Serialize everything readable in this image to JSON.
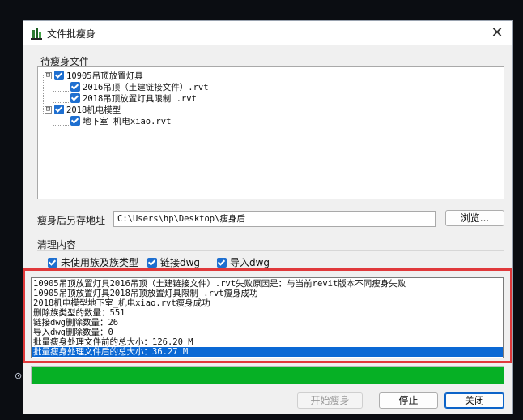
{
  "window": {
    "title": "文件批瘦身",
    "close_glyph": "✕"
  },
  "files_section": {
    "label": "待瘦身文件",
    "tree": [
      {
        "label": "10905吊顶放置灯具",
        "expander": "⊟",
        "checked": true,
        "children": [
          {
            "label": "2016吊顶（土建链接文件）.rvt",
            "checked": true
          },
          {
            "label": "2018吊顶放置灯具限制 .rvt",
            "checked": true
          }
        ]
      },
      {
        "label": "2018机电模型",
        "expander": "⊟",
        "checked": true,
        "children": [
          {
            "label": "地下室_机电xiao.rvt",
            "checked": true
          }
        ]
      }
    ]
  },
  "save_path": {
    "label": "瘦身后另存地址",
    "value": "C:\\Users\\hp\\Desktop\\瘦身后",
    "browse_label": "浏览..."
  },
  "cleanup": {
    "label": "清理内容",
    "options": [
      {
        "label": "未使用族及族类型",
        "checked": true
      },
      {
        "label": "链接dwg",
        "checked": true
      },
      {
        "label": "导入dwg",
        "checked": true
      }
    ]
  },
  "log": {
    "lines": [
      "10905吊顶放置灯具2016吊顶（土建链接文件）.rvt失败原因是：与当前revit版本不同瘦身失败",
      "10905吊顶放置灯具2018吊顶放置灯具限制 .rvt瘦身成功",
      "2018机电模型地下室_机电xiao.rvt瘦身成功",
      "删除族类型的数量：551",
      "链接dwg删除数量：26",
      "导入dwg删除数量：0",
      "批量瘦身处理文件前的总大小：126.20 M",
      "批量瘦身处理文件后的总大小：36.27 M"
    ],
    "selected_index": 7
  },
  "progress": {
    "percent": 100,
    "color": "#06b025"
  },
  "buttons": {
    "start": "开始瘦身",
    "stop": "停止",
    "close": "关闭"
  },
  "highlight_color": "#e0393b"
}
